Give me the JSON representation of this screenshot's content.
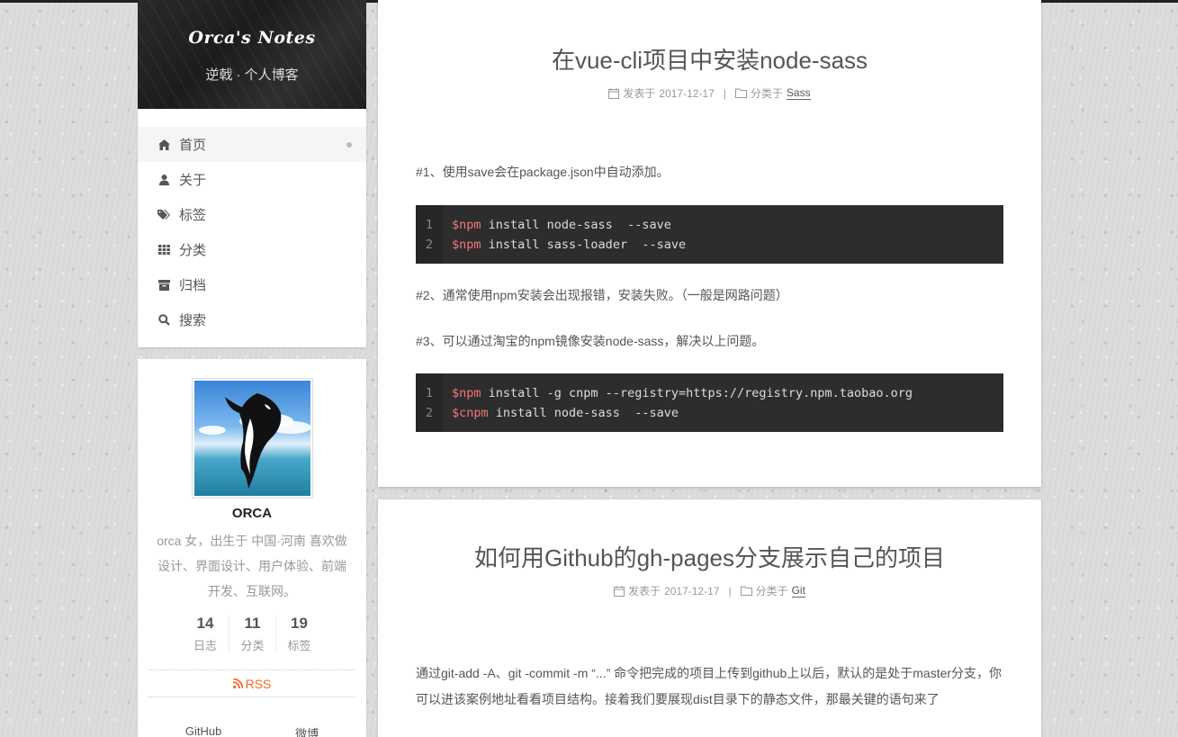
{
  "site": {
    "title": "Orca's Notes",
    "subtitle": "逆戟 · 个人博客"
  },
  "menu": {
    "items": [
      {
        "label": "首页",
        "icon": "home-icon",
        "active": true
      },
      {
        "label": "关于",
        "icon": "user-icon"
      },
      {
        "label": "标签",
        "icon": "tags-icon"
      },
      {
        "label": "分类",
        "icon": "th-icon"
      },
      {
        "label": "归档",
        "icon": "archive-icon"
      },
      {
        "label": "搜索",
        "icon": "search-icon"
      }
    ]
  },
  "author": {
    "name": "ORCA",
    "description": "orca 女，出生于 中国·河南 喜欢做设计、界面设计、用户体验、前端开发、互联网。",
    "stats": [
      {
        "count": "14",
        "label": "日志"
      },
      {
        "count": "11",
        "label": "分类"
      },
      {
        "count": "19",
        "label": "标签"
      }
    ],
    "rss": "RSS",
    "links": [
      "GitHub",
      "微博"
    ]
  },
  "posts": [
    {
      "title": "在vue-cli项目中安装node-sass",
      "posted_label": "发表于",
      "date": "2017-12-17",
      "category_label": "分类于",
      "category": "Sass",
      "paragraphs": [
        "#1、使用save会在package.json中自动添加。",
        "#2、通常使用npm安装会出现报错，安装失败。（一般是网路问题）",
        "#3、可以通过淘宝的npm镜像安装node-sass，解决以上问题。"
      ],
      "code_blocks": [
        {
          "lines": [
            {
              "num": "1",
              "prompt": "$npm",
              "cmd": " install node-sass  --save"
            },
            {
              "num": "2",
              "prompt": "$npm",
              "cmd": " install sass-loader  --save"
            }
          ]
        },
        {
          "lines": [
            {
              "num": "1",
              "prompt": "$npm",
              "cmd": " install -g cnpm --registry=https://registry.npm.taobao.org"
            },
            {
              "num": "2",
              "prompt": "$cnpm",
              "cmd": " install node-sass  --save"
            }
          ]
        }
      ]
    },
    {
      "title": "如何用Github的gh-pages分支展示自己的项目",
      "posted_label": "发表于",
      "date": "2017-12-17",
      "category_label": "分类于",
      "category": "Git",
      "paragraphs": [
        "通过git-add -A、git -commit -m “...” 命令把完成的项目上传到github上以后，默认的是处于master分支，你可以进该案例地址看看项目结构。接着我们要展现dist目录下的静态文件，那最关键的语句来了"
      ]
    }
  ],
  "colors": {
    "rss": "#fc6423",
    "code_bg": "#2d2d2d",
    "code_prompt": "#f2777a"
  }
}
